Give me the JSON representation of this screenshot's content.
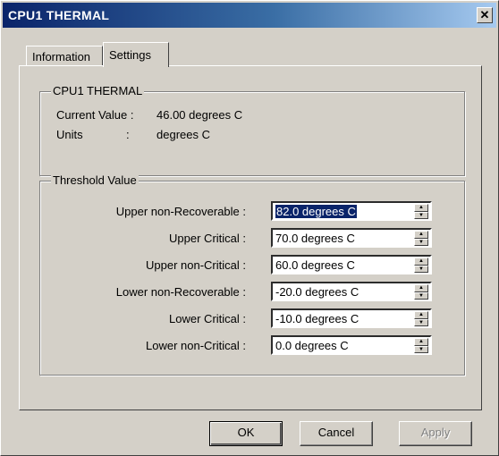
{
  "window": {
    "title": "CPU1 THERMAL",
    "close_label": "✕"
  },
  "tabs": [
    {
      "label": "Information"
    },
    {
      "label": "Settings"
    }
  ],
  "sensor_group": {
    "title": "CPU1 THERMAL",
    "current_value_label": "Current Value :",
    "current_value": "46.00 degrees C",
    "units_label": "Units",
    "units_sep": ":",
    "units_value": "degrees C"
  },
  "threshold_group": {
    "title": "Threshold Value",
    "rows": [
      {
        "label": "Upper non-Recoverable :",
        "value": "82.0 degrees C"
      },
      {
        "label": "Upper Critical :",
        "value": "70.0 degrees C"
      },
      {
        "label": "Upper non-Critical :",
        "value": "60.0 degrees C"
      },
      {
        "label": "Lower non-Recoverable :",
        "value": "-20.0 degrees C"
      },
      {
        "label": "Lower Critical :",
        "value": "-10.0 degrees C"
      },
      {
        "label": "Lower non-Critical :",
        "value": "0.0 degrees C"
      }
    ]
  },
  "buttons": {
    "ok": "OK",
    "cancel": "Cancel",
    "apply": "Apply"
  },
  "colors": {
    "titlebar_start": "#0a246a",
    "titlebar_end": "#a6caf0",
    "dialog_bg": "#d4d0c8",
    "selection": "#0a246a"
  }
}
